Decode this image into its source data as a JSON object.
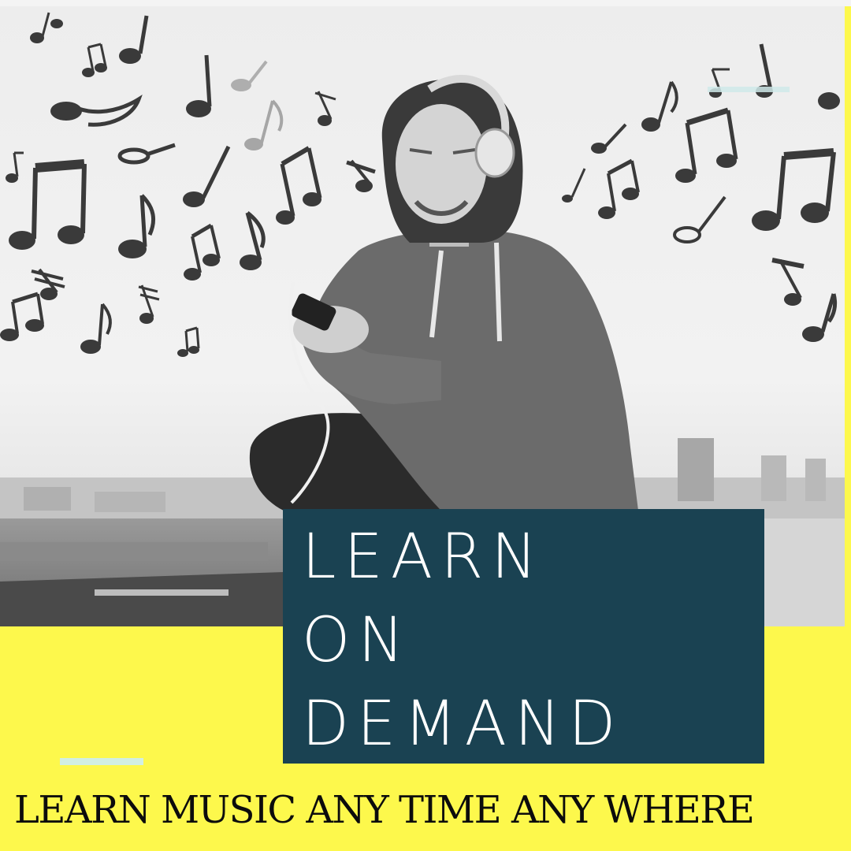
{
  "headline": {
    "line1": "LEARN",
    "line2": "ON",
    "line3": "DEMAND"
  },
  "tagline": "LEARN MUSIC ANY TIME ANY WHERE",
  "colors": {
    "background": "#fdf84c",
    "headline_box": "#1a4252",
    "headline_text": "#ffffff",
    "tagline_text": "#0c0c0c",
    "accent_dash": "#d2efe2"
  },
  "photo": {
    "subject": "woman-with-headphones-and-phone-icon",
    "decoration": "music-notes-icon"
  }
}
